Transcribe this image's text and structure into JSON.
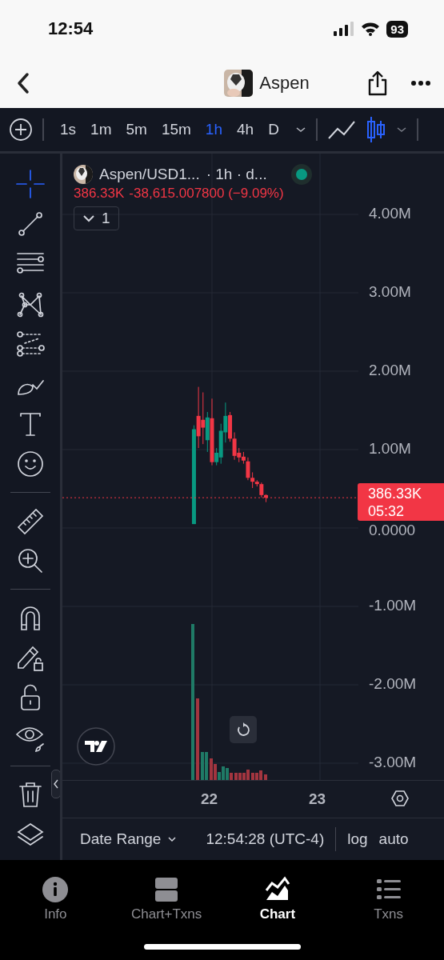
{
  "status_bar": {
    "time": "12:54",
    "battery": "93"
  },
  "header": {
    "title": "Aspen"
  },
  "timeframes": [
    {
      "label": "1s",
      "selected": false
    },
    {
      "label": "1m",
      "selected": false
    },
    {
      "label": "5m",
      "selected": false
    },
    {
      "label": "15m",
      "selected": false
    },
    {
      "label": "1h",
      "selected": true
    },
    {
      "label": "4h",
      "selected": false
    },
    {
      "label": "D",
      "selected": false
    }
  ],
  "chart_types": [
    {
      "kind": "line",
      "selected": false
    },
    {
      "kind": "candles",
      "selected": true
    }
  ],
  "tool_groups": [
    [
      {
        "kind": "crosshair",
        "selected": true
      },
      {
        "kind": "trend-line",
        "selected": false
      },
      {
        "kind": "parallel-lines",
        "selected": false
      },
      {
        "kind": "pattern",
        "selected": false
      },
      {
        "kind": "fib",
        "selected": false
      },
      {
        "kind": "brush",
        "selected": false
      },
      {
        "kind": "text",
        "selected": false
      },
      {
        "kind": "emoji",
        "selected": false
      }
    ],
    [
      {
        "kind": "ruler",
        "selected": false
      },
      {
        "kind": "zoom",
        "selected": false
      }
    ],
    [
      {
        "kind": "magnet",
        "selected": false
      },
      {
        "kind": "pencil-lock",
        "selected": false
      },
      {
        "kind": "lock",
        "selected": false
      },
      {
        "kind": "eye",
        "selected": false
      }
    ],
    [
      {
        "kind": "trash",
        "selected": false
      },
      {
        "kind": "layers",
        "selected": false
      }
    ]
  ],
  "legend": {
    "symbol": "Aspen/USD1...",
    "interval": "· 1h · d...",
    "live": true,
    "price": "386.33K",
    "change": "-38,615.007800 (−9.09%)",
    "collapse_count": "1"
  },
  "chart_data": {
    "type": "candlestick",
    "x": [
      21.833,
      21.875,
      21.917,
      21.958,
      22,
      22.042,
      22.083,
      22.125,
      22.167,
      22.208,
      22.25,
      22.292,
      22.333,
      22.375,
      22.417,
      22.458,
      22.5
    ],
    "ohlc": [
      [
        50000,
        1310000,
        50000,
        1260000
      ],
      [
        1430000,
        1800000,
        1020000,
        1170000
      ],
      [
        1380000,
        1730000,
        1070000,
        1280000
      ],
      [
        1120000,
        1480000,
        970000,
        1410000
      ],
      [
        1400000,
        1650000,
        800000,
        840000
      ],
      [
        840000,
        1020000,
        800000,
        960000
      ],
      [
        900000,
        1330000,
        820000,
        1240000
      ],
      [
        1220000,
        1600000,
        1090000,
        1430000
      ],
      [
        1440000,
        1480000,
        1100000,
        1140000
      ],
      [
        1140000,
        1220000,
        870000,
        920000
      ],
      [
        960000,
        1020000,
        840000,
        900000
      ],
      [
        910000,
        970000,
        820000,
        860000
      ],
      [
        850000,
        900000,
        610000,
        640000
      ],
      [
        640000,
        710000,
        510000,
        590000
      ],
      [
        590000,
        610000,
        530000,
        560000
      ],
      [
        560000,
        580000,
        390000,
        420000
      ],
      [
        420000,
        430000,
        330000,
        386330
      ]
    ],
    "xlim": [
      20.615,
      24.148
    ],
    "ylim": [
      -4234694,
      4775510
    ],
    "grid": true,
    "ref_lines": [
      {
        "axis": "y",
        "value": 386330,
        "color": "#f23645"
      }
    ],
    "xticks": [
      22,
      23
    ],
    "yticks": [
      {
        "value": 4000000,
        "label": "4.00M"
      },
      {
        "value": 3000000,
        "label": "3.00M"
      },
      {
        "value": 2000000,
        "label": "2.00M"
      },
      {
        "value": 1000000,
        "label": "1.00M"
      },
      {
        "value": 0,
        "label": "0.0000"
      },
      {
        "value": -1000000,
        "label": "-1.00M"
      },
      {
        "value": -2000000,
        "label": "-2.00M"
      },
      {
        "value": -3000000,
        "label": "-3.00M"
      }
    ]
  },
  "price_tag": {
    "price": "386.33K",
    "countdown": "05:32"
  },
  "bottom_bar": {
    "date_range": "Date Range",
    "clock": "12:54:28 (UTC-4)",
    "log": "log",
    "auto": "auto"
  },
  "tabs": [
    {
      "kind": "info",
      "label": "Info",
      "selected": false
    },
    {
      "kind": "split",
      "label": "Chart+Txns",
      "selected": false
    },
    {
      "kind": "chart",
      "label": "Chart",
      "selected": true
    },
    {
      "kind": "list",
      "label": "Txns",
      "selected": false
    }
  ]
}
